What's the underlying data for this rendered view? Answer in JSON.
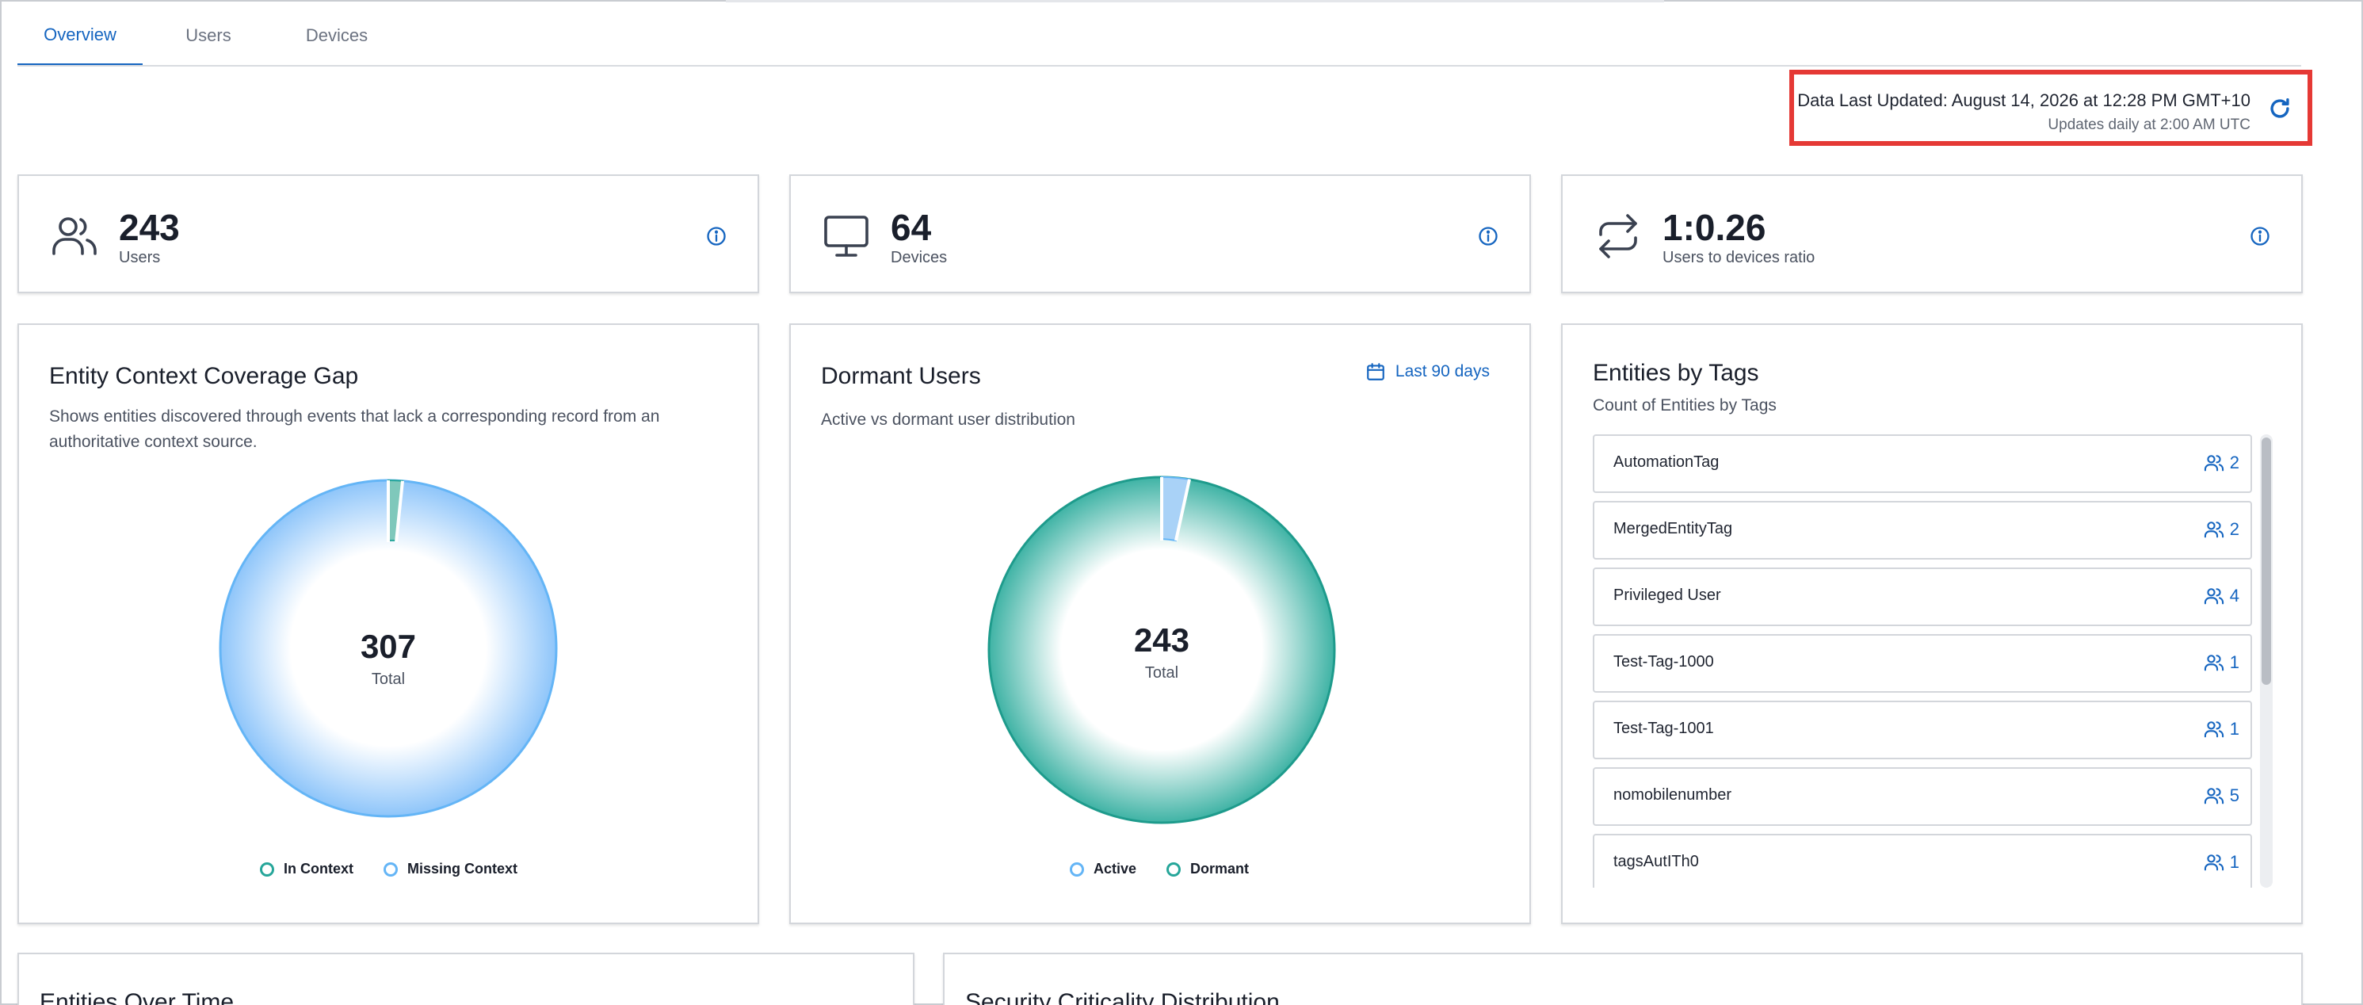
{
  "tabs": [
    {
      "label": "Overview",
      "active": true
    },
    {
      "label": "Users",
      "active": false
    },
    {
      "label": "Devices",
      "active": false
    },
    {
      "label": "",
      "active": false
    },
    {
      "label": "",
      "active": false
    }
  ],
  "update": {
    "main": "Data Last Updated: August 14, 2026 at 12:28 PM GMT+10",
    "sub": "Updates daily at 2:00 AM UTC",
    "refresh_icon": "refresh-icon"
  },
  "stats": {
    "users": {
      "value": "243",
      "label": "Users",
      "icon": "users-icon"
    },
    "devices": {
      "value": "64",
      "label": "Devices",
      "icon": "monitor-icon"
    },
    "ratio": {
      "value": "1:0.26",
      "label": "Users to devices ratio",
      "icon": "swap-icon"
    }
  },
  "coverage": {
    "title": "Entity Context Coverage Gap",
    "description": "Shows entities discovered through events that lack a corresponding record from an authoritative context source.",
    "total": "307",
    "total_label": "Total",
    "legend": [
      "In Context",
      "Missing Context"
    ],
    "colors": {
      "in_context": "#26a69a",
      "missing": "#64b5f6"
    }
  },
  "dormant": {
    "title": "Dormant Users",
    "description": "Active vs dormant user distribution",
    "range_label": "Last 90 days",
    "total": "243",
    "total_label": "Total",
    "legend": [
      "Active",
      "Dormant"
    ],
    "colors": {
      "active": "#64b5f6",
      "dormant": "#26a69a"
    }
  },
  "tags": {
    "title": "Entities by Tags",
    "subtitle": "Count of Entities by Tags",
    "items": [
      {
        "name": "AutomationTag",
        "count": "2"
      },
      {
        "name": "MergedEntityTag",
        "count": "2"
      },
      {
        "name": "Privileged User",
        "count": "4"
      },
      {
        "name": "Test-Tag-1000",
        "count": "1"
      },
      {
        "name": "Test-Tag-1001",
        "count": "1"
      },
      {
        "name": "nomobilenumber",
        "count": "5"
      },
      {
        "name": "tagsAutITh0",
        "count": "1"
      }
    ]
  },
  "bottom": {
    "left_title": "Entities Over Time",
    "right_title": "Security Criticality Distribution"
  },
  "accent_color": "#1565c0"
}
